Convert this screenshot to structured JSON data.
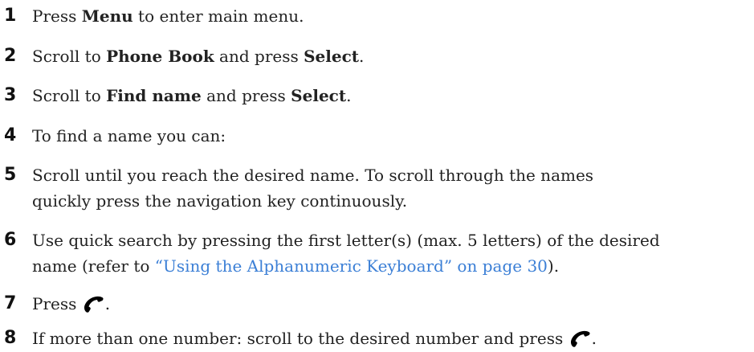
{
  "steps": [
    {
      "number": "1",
      "parts": [
        "Press ",
        "Menu",
        " to enter main menu."
      ]
    },
    {
      "number": "2",
      "parts": [
        "Scroll to ",
        "Phone Book",
        " and press ",
        "Select",
        "."
      ]
    },
    {
      "number": "3",
      "parts": [
        "Scroll to ",
        "Find name",
        " and press ",
        "Select",
        "."
      ]
    },
    {
      "number": "4",
      "parts": [
        "To find a name you can:"
      ]
    },
    {
      "number": "5",
      "lines": [
        "Scroll until you reach the desired name. To scroll through the names",
        "quickly press the navigation key continuously."
      ]
    },
    {
      "number": "6",
      "line1": "Use quick search by pressing the first letter(s) (max. 5 letters) of the desired",
      "line2_pre": "name (refer to ",
      "line2_link": "“Using the Alphanumeric Keyboard” on page 30",
      "line2_post": ")."
    },
    {
      "number": "7",
      "pre": "Press ",
      "post": "."
    },
    {
      "number": "8",
      "pre": "If more than one number: scroll to the desired number and press ",
      "post": "."
    }
  ],
  "icons": {
    "call_key": "phone-handset-icon"
  },
  "colors": {
    "link": "#3b7fd6",
    "text": "#222222"
  }
}
